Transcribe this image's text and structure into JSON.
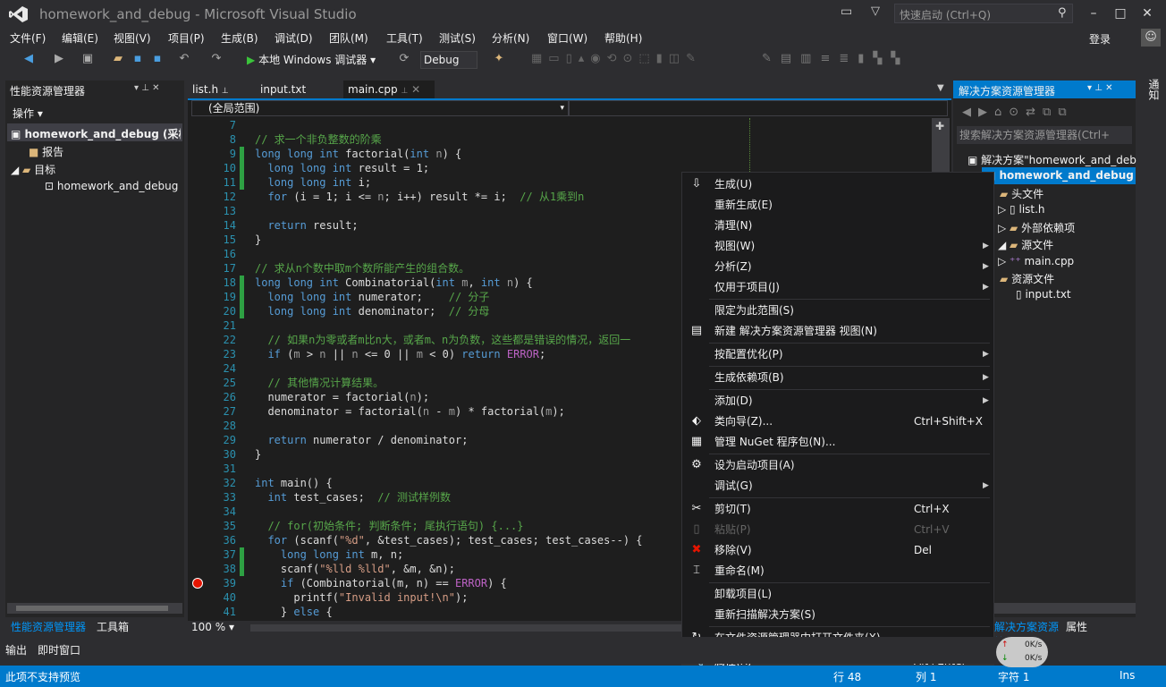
{
  "window": {
    "title": "homework_and_debug - Microsoft Visual Studio",
    "quick_launch_placeholder": "快速启动 (Ctrl+Q)",
    "login": "登录"
  },
  "menu": [
    "文件(F)",
    "编辑(E)",
    "视图(V)",
    "项目(P)",
    "生成(B)",
    "调试(D)",
    "团队(M)",
    "工具(T)",
    "测试(S)",
    "分析(N)",
    "窗口(W)",
    "帮助(H)"
  ],
  "toolbar": {
    "debugger_label": "本地 Windows 调试器",
    "configuration": "Debug"
  },
  "left_panel": {
    "title": "性能资源管理器",
    "actions_label": "操作",
    "tree": [
      {
        "label": "homework_and_debug (采样"
      },
      {
        "label": "报告"
      },
      {
        "label": "目标"
      },
      {
        "label": "homework_and_debug"
      }
    ],
    "tabs": [
      "性能资源管理器",
      "工具箱"
    ]
  },
  "editor": {
    "tabs": [
      "list.h",
      "input.txt",
      "main.cpp"
    ],
    "active_tab": "main.cpp",
    "scope": "(全局范围)",
    "zoom": "100 %",
    "breakpoint_line": 39
  },
  "code_lines": [
    {
      "n": "7",
      "html": ""
    },
    {
      "n": "8",
      "html": "<span class='cm'>// 求一个非负整数的阶乘</span>"
    },
    {
      "n": "9",
      "html": "<span class='kw'>long long int</span> factorial(<span class='kw'>int</span> <span class='prm'>n</span>) {",
      "chg": true
    },
    {
      "n": "10",
      "html": "  <span class='kw'>long long int</span> result = 1;",
      "chg": true
    },
    {
      "n": "11",
      "html": "  <span class='kw'>long long int</span> i;",
      "chg": true
    },
    {
      "n": "12",
      "html": "  <span class='kw'>for</span> (i = 1; i &lt;= <span class='prm'>n</span>; i++) result *= i;  <span class='cm'>// 从1乘到n</span>"
    },
    {
      "n": "13",
      "html": ""
    },
    {
      "n": "14",
      "html": "  <span class='kw'>return</span> result;"
    },
    {
      "n": "15",
      "html": "}"
    },
    {
      "n": "16",
      "html": ""
    },
    {
      "n": "17",
      "html": "<span class='cm'>// 求从n个数中取m个数所能产生的组合数。</span>"
    },
    {
      "n": "18",
      "html": "<span class='kw'>long long int</span> Combinatorial(<span class='kw'>int</span> <span class='prm'>m</span>, <span class='kw'>int</span> <span class='prm'>n</span>) {",
      "chg": true
    },
    {
      "n": "19",
      "html": "  <span class='kw'>long long int</span> numerator;    <span class='cm'>// 分子</span>",
      "chg": true
    },
    {
      "n": "20",
      "html": "  <span class='kw'>long long int</span> denominator;  <span class='cm'>// 分母</span>",
      "chg": true
    },
    {
      "n": "21",
      "html": ""
    },
    {
      "n": "22",
      "html": "  <span class='cm'>// 如果n为零或者m比n大，或者m、n为负数，这些都是错误的情况，返回一</span>"
    },
    {
      "n": "23",
      "html": "  <span class='kw'>if</span> (<span class='prm'>m</span> &gt; <span class='prm'>n</span> || <span class='prm'>n</span> &lt;= 0 || <span class='prm'>m</span> &lt; 0) <span class='kw'>return</span> <span class='mac'>ERROR</span>;"
    },
    {
      "n": "24",
      "html": ""
    },
    {
      "n": "25",
      "html": "  <span class='cm'>// 其他情况计算结果。</span>"
    },
    {
      "n": "26",
      "html": "  numerator = factorial(<span class='prm'>n</span>);"
    },
    {
      "n": "27",
      "html": "  denominator = factorial(<span class='prm'>n</span> - <span class='prm'>m</span>) * factorial(<span class='prm'>m</span>);"
    },
    {
      "n": "28",
      "html": ""
    },
    {
      "n": "29",
      "html": "  <span class='kw'>return</span> numerator / denominator;"
    },
    {
      "n": "30",
      "html": "}"
    },
    {
      "n": "31",
      "html": ""
    },
    {
      "n": "32",
      "html": "<span class='kw'>int</span> main() {"
    },
    {
      "n": "33",
      "html": "  <span class='kw'>int</span> test_cases;  <span class='cm'>// 测试样例数</span>"
    },
    {
      "n": "34",
      "html": ""
    },
    {
      "n": "35",
      "html": "  <span class='cm'>// for(初始条件; 判断条件; 尾执行语句) {...}</span>"
    },
    {
      "n": "36",
      "html": "  <span class='kw'>for</span> (scanf(<span class='st'>\"%d\"</span>, &amp;test_cases); test_cases; test_cases--) {"
    },
    {
      "n": "37",
      "html": "    <span class='kw'>long long int</span> m, n;",
      "chg": true
    },
    {
      "n": "38",
      "html": "    scanf(<span class='st'>\"%lld %lld\"</span>, &amp;m, &amp;n);",
      "chg": true
    },
    {
      "n": "39",
      "html": "    <span class='kw'>if</span> (Combinatorial(m, n) == <span class='mac'>ERROR</span>) {"
    },
    {
      "n": "40",
      "html": "      printf(<span class='st'>\"Invalid input!\\n\"</span>);"
    },
    {
      "n": "41",
      "html": "    } <span class='kw'>else</span> {"
    }
  ],
  "right_panel": {
    "title": "解决方案资源管理器",
    "search_placeholder": "搜索解决方案资源管理器(Ctrl+",
    "tree": [
      {
        "label": "解决方案\"homework_and_deb"
      },
      {
        "label": "homework_and_debug"
      },
      {
        "label": "头文件"
      },
      {
        "label": "list.h"
      },
      {
        "label": "外部依赖项"
      },
      {
        "label": "源文件"
      },
      {
        "label": "main.cpp"
      },
      {
        "label": "资源文件"
      },
      {
        "label": "input.txt"
      }
    ],
    "tabs": [
      "解决方案资源管理器",
      "属性"
    ],
    "notifications": "通知"
  },
  "context_menu": [
    {
      "label": "生成(U)",
      "icon": "build-icon"
    },
    {
      "label": "重新生成(E)"
    },
    {
      "label": "清理(N)"
    },
    {
      "label": "视图(W)",
      "arrow": true
    },
    {
      "label": "分析(Z)",
      "arrow": true
    },
    {
      "label": "仅用于项目(J)",
      "arrow": true
    },
    {
      "sep": true
    },
    {
      "label": "限定为此范围(S)"
    },
    {
      "label": "新建 解决方案资源管理器 视图(N)",
      "icon": "new-view-icon"
    },
    {
      "sep": true
    },
    {
      "label": "按配置优化(P)",
      "arrow": true
    },
    {
      "sep": true
    },
    {
      "label": "生成依赖项(B)",
      "arrow": true
    },
    {
      "sep": true
    },
    {
      "label": "添加(D)",
      "arrow": true
    },
    {
      "label": "类向导(Z)...",
      "shortcut": "Ctrl+Shift+X",
      "icon": "class-wizard-icon"
    },
    {
      "label": "管理 NuGet 程序包(N)...",
      "icon": "nuget-icon"
    },
    {
      "sep": true
    },
    {
      "label": "设为启动项目(A)",
      "icon": "gear-icon"
    },
    {
      "label": "调试(G)",
      "arrow": true
    },
    {
      "sep": true
    },
    {
      "label": "剪切(T)",
      "shortcut": "Ctrl+X",
      "icon": "scissors-icon"
    },
    {
      "label": "粘贴(P)",
      "shortcut": "Ctrl+V",
      "disabled": true,
      "icon": "paste-icon"
    },
    {
      "label": "移除(V)",
      "shortcut": "Del",
      "icon": "remove-icon"
    },
    {
      "label": "重命名(M)",
      "icon": "rename-icon"
    },
    {
      "sep": true
    },
    {
      "label": "卸载项目(L)"
    },
    {
      "label": "重新扫描解决方案(S)"
    },
    {
      "sep": true
    },
    {
      "label": "在文件资源管理器中打开文件夹(X)",
      "icon": "open-folder-icon"
    },
    {
      "sep": true
    },
    {
      "label": "属性(R)",
      "shortcut": "Alt+Enter",
      "icon": "wrench-icon",
      "hover": true
    }
  ],
  "output_tabs": [
    "输出",
    "即时窗口"
  ],
  "statusbar": {
    "message": "此项不支持预览",
    "line": "行 48",
    "col": "列 1",
    "char": "字符 1",
    "mode": "Ins"
  },
  "net_widget": {
    "up": "0K/s",
    "down": "0K/s"
  },
  "colors": {
    "accent": "#007acc",
    "breakpoint": "#e51400",
    "change_bar": "#2ea043"
  }
}
